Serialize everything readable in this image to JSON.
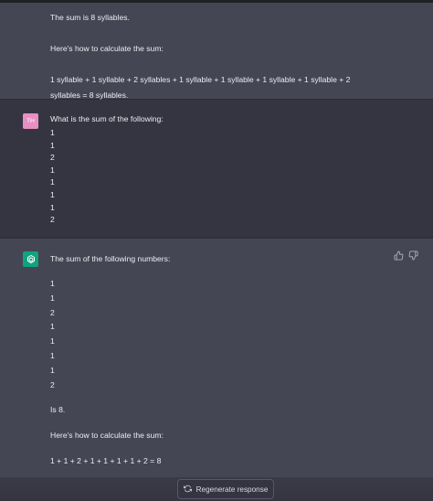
{
  "messages": [
    {
      "role": "assistant",
      "lines": [
        "The sum is 8 syllables.",
        "",
        "Here's how to calculate the sum:",
        "",
        "1 syllable + 1 syllable + 2 syllables + 1 syllable + 1 syllable + 1 syllable + 1 syllable + 2",
        "syllables = 8 syllables."
      ]
    },
    {
      "role": "user",
      "avatar_initials": "TH",
      "lines": [
        "What is the sum of the following:",
        "1",
        "1",
        "2",
        "1",
        "1",
        "1",
        "1",
        "2"
      ]
    },
    {
      "role": "assistant",
      "lines": [
        "The sum of the following numbers:",
        "",
        "1",
        "1",
        "2",
        "1",
        "1",
        "1",
        "1",
        "2",
        "",
        "Is 8.",
        "",
        "Here's how to calculate the sum:",
        "",
        "1 + 1 + 2 + 1 + 1 + 1 + 1 + 2 = 8"
      ]
    }
  ],
  "footer": {
    "regenerate_label": "Regenerate response"
  },
  "icons": {
    "user_avatar_color": "#e78ec5",
    "assistant_avatar_color": "#10a37f",
    "thumbs_up": "thumbs-up-icon",
    "thumbs_down": "thumbs-down-icon",
    "regenerate": "refresh-icon"
  }
}
